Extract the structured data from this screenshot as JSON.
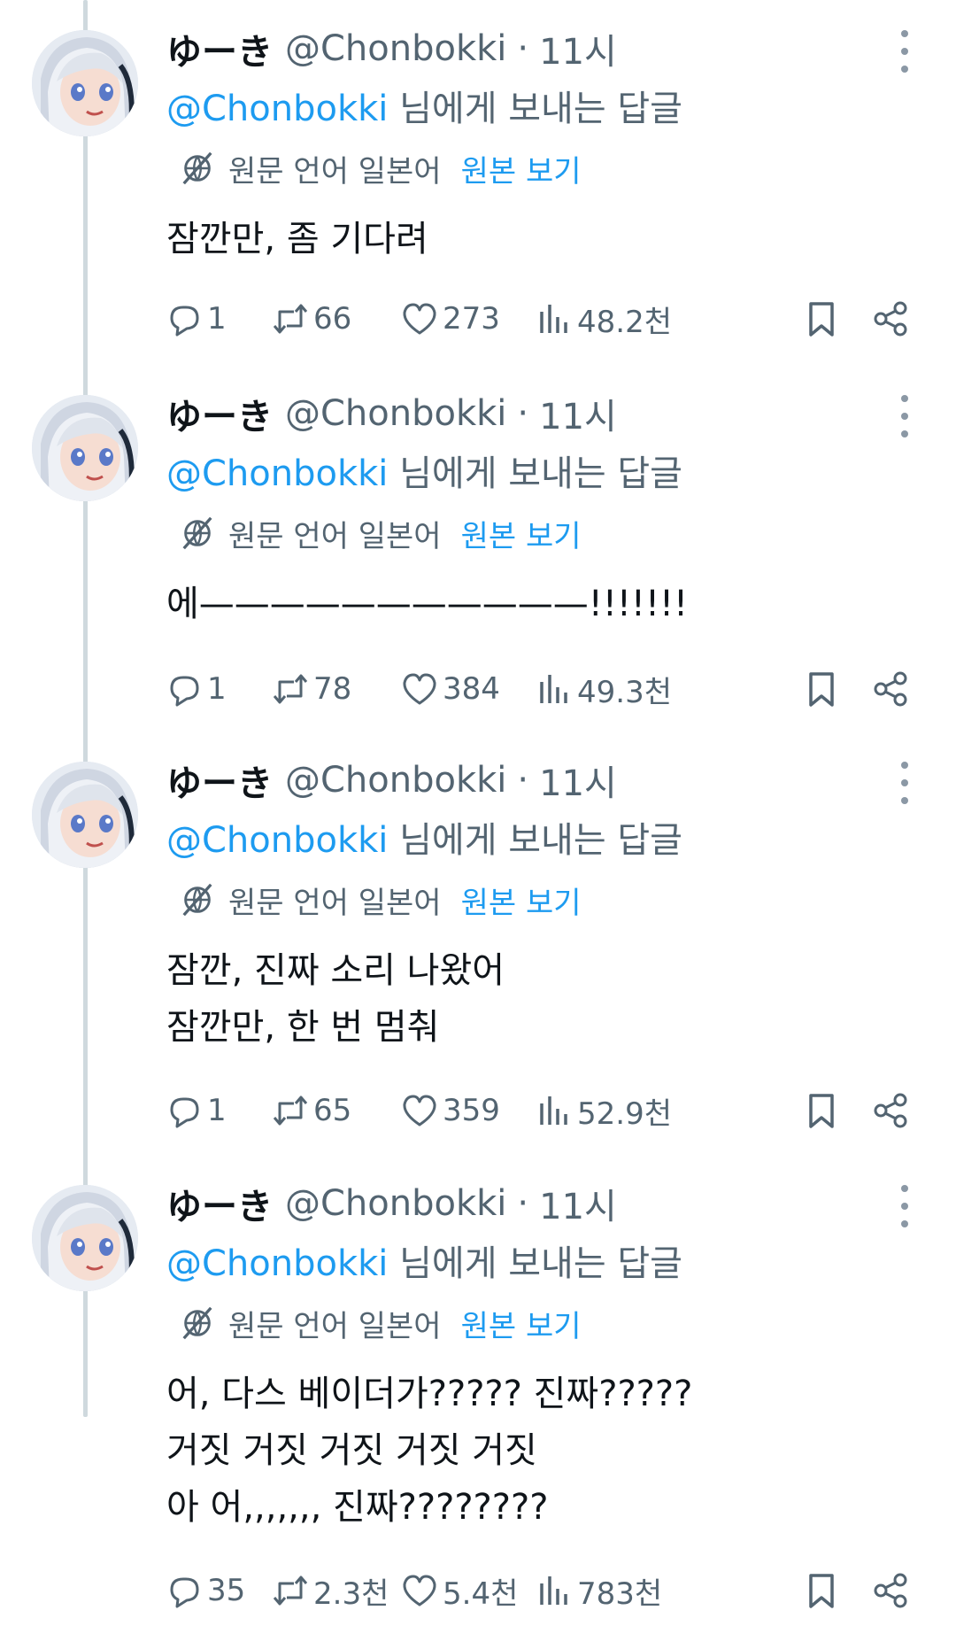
{
  "tweets": [
    {
      "name": "ゆーき",
      "handle": "@Chonbokki",
      "dot": "·",
      "time": "11시",
      "replying_mention": "@Chonbokki",
      "replying_suffix": " 님에게 보내는 답글",
      "translate_label": "원문 언어 일본어",
      "show_original": "원본 보기",
      "lines": [
        "잠깐만, 좀 기다려"
      ],
      "stats": {
        "replies": "1",
        "retweets": "66",
        "likes": "273",
        "views": "48.2천"
      }
    },
    {
      "name": "ゆーき",
      "handle": "@Chonbokki",
      "dot": "·",
      "time": "11시",
      "replying_mention": "@Chonbokki",
      "replying_suffix": " 님에게 보내는 답글",
      "translate_label": "원문 언어 일본어",
      "show_original": "원본 보기",
      "lines": [
        "에———————————!!!!!!!"
      ],
      "stats": {
        "replies": "1",
        "retweets": "78",
        "likes": "384",
        "views": "49.3천"
      }
    },
    {
      "name": "ゆーき",
      "handle": "@Chonbokki",
      "dot": "·",
      "time": "11시",
      "replying_mention": "@Chonbokki",
      "replying_suffix": " 님에게 보내는 답글",
      "translate_label": "원문 언어 일본어",
      "show_original": "원본 보기",
      "lines": [
        "잠깐, 진짜 소리 나왔어",
        "잠깐만, 한 번 멈춰"
      ],
      "stats": {
        "replies": "1",
        "retweets": "65",
        "likes": "359",
        "views": "52.9천"
      }
    },
    {
      "name": "ゆーき",
      "handle": "@Chonbokki",
      "dot": "·",
      "time": "11시",
      "replying_mention": "@Chonbokki",
      "replying_suffix": " 님에게 보내는 답글",
      "translate_label": "원문 언어 일본어",
      "show_original": "원본 보기",
      "lines": [
        "어, 다스 베이더가????? 진짜?????",
        "거짓 거짓 거짓 거짓 거짓",
        "아 어,,,,,,, 진짜????????"
      ],
      "stats": {
        "replies": "35",
        "retweets": "2.3천",
        "likes": "5.4천",
        "views": "783천"
      }
    }
  ],
  "icons": {
    "reply": "speech-bubble-icon",
    "retweet": "retweet-arrows-icon",
    "like": "heart-icon",
    "views": "bar-chart-icon",
    "bookmark": "bookmark-icon",
    "share": "share-icon",
    "more": "more-dots-icon",
    "translate": "translate-icon"
  },
  "colors": {
    "link": "#1d9bf0",
    "secondary": "#536471",
    "text": "#0f1419",
    "thread_line": "#cfd9de"
  }
}
